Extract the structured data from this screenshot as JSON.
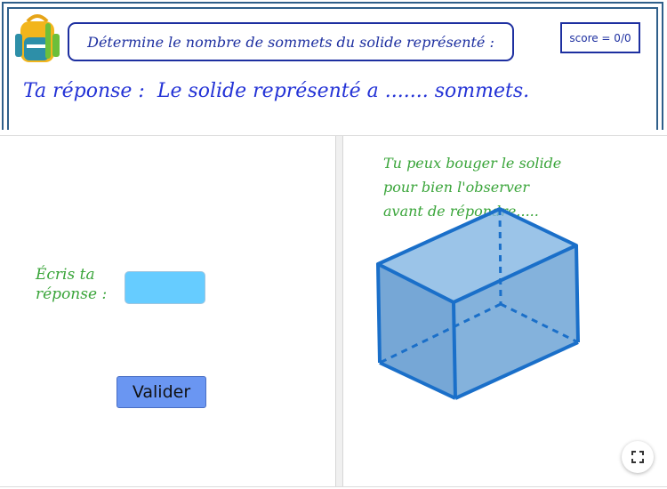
{
  "header": {
    "question": "Détermine le nombre de sommets du solide représenté :",
    "score": "score = 0/0",
    "answer_label": "Ta réponse :",
    "answer_sentence": "Le solide représenté a ....... sommets."
  },
  "left_panel": {
    "input_label_line1": "Écris ta",
    "input_label_line2": "réponse :",
    "input_value": "",
    "submit_label": "Valider"
  },
  "right_panel": {
    "hint_line1": "Tu peux bouger le solide",
    "hint_line2": "pour bien l'observer",
    "hint_line3": "avant de répondre.....",
    "fullscreen_icon": "fullscreen-icon"
  },
  "colors": {
    "frame": "#2f5f8a",
    "question_text": "#1d2fa0",
    "answer_text": "#2433d6",
    "hint_text": "#3aa53a",
    "input_bg": "#66ccff",
    "button_bg": "#6a96f2",
    "solid_face": "#6fa8d8",
    "solid_edge": "#1a6fc9"
  }
}
